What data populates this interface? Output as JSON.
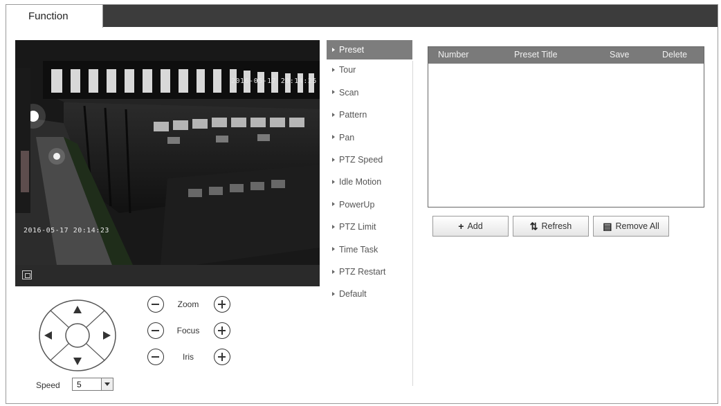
{
  "tab": {
    "label": "Function"
  },
  "video": {
    "osd_time_top": "2016-05-17 20:14:25",
    "osd_time_bottom": "2016-05-17 20:14:23"
  },
  "ptz": {
    "zoom_label": "Zoom",
    "focus_label": "Focus",
    "iris_label": "Iris",
    "speed_label": "Speed",
    "speed_value": "5"
  },
  "menu": {
    "items": [
      {
        "label": "Preset",
        "active": true
      },
      {
        "label": "Tour"
      },
      {
        "label": "Scan"
      },
      {
        "label": "Pattern"
      },
      {
        "label": "Pan"
      },
      {
        "label": "PTZ Speed"
      },
      {
        "label": "Idle Motion"
      },
      {
        "label": "PowerUp"
      },
      {
        "label": "PTZ Limit"
      },
      {
        "label": "Time Task"
      },
      {
        "label": "PTZ Restart"
      },
      {
        "label": "Default"
      }
    ]
  },
  "table": {
    "columns": [
      "Number",
      "Preset Title",
      "Save",
      "Delete"
    ],
    "rows": []
  },
  "buttons": {
    "add": "Add",
    "refresh": "Refresh",
    "remove_all": "Remove All"
  },
  "icons": {
    "fullscreen": "fullscreen-icon",
    "up": "arrow-up-icon",
    "down": "arrow-down-icon",
    "left": "arrow-left-icon",
    "right": "arrow-right-icon",
    "add": "plus-icon",
    "refresh": "refresh-icon",
    "remove_all": "trash-icon"
  },
  "colors": {
    "tabbar": "#3c3c3c",
    "menu_active": "#7d7d7d",
    "table_header": "#7a7a7a"
  }
}
